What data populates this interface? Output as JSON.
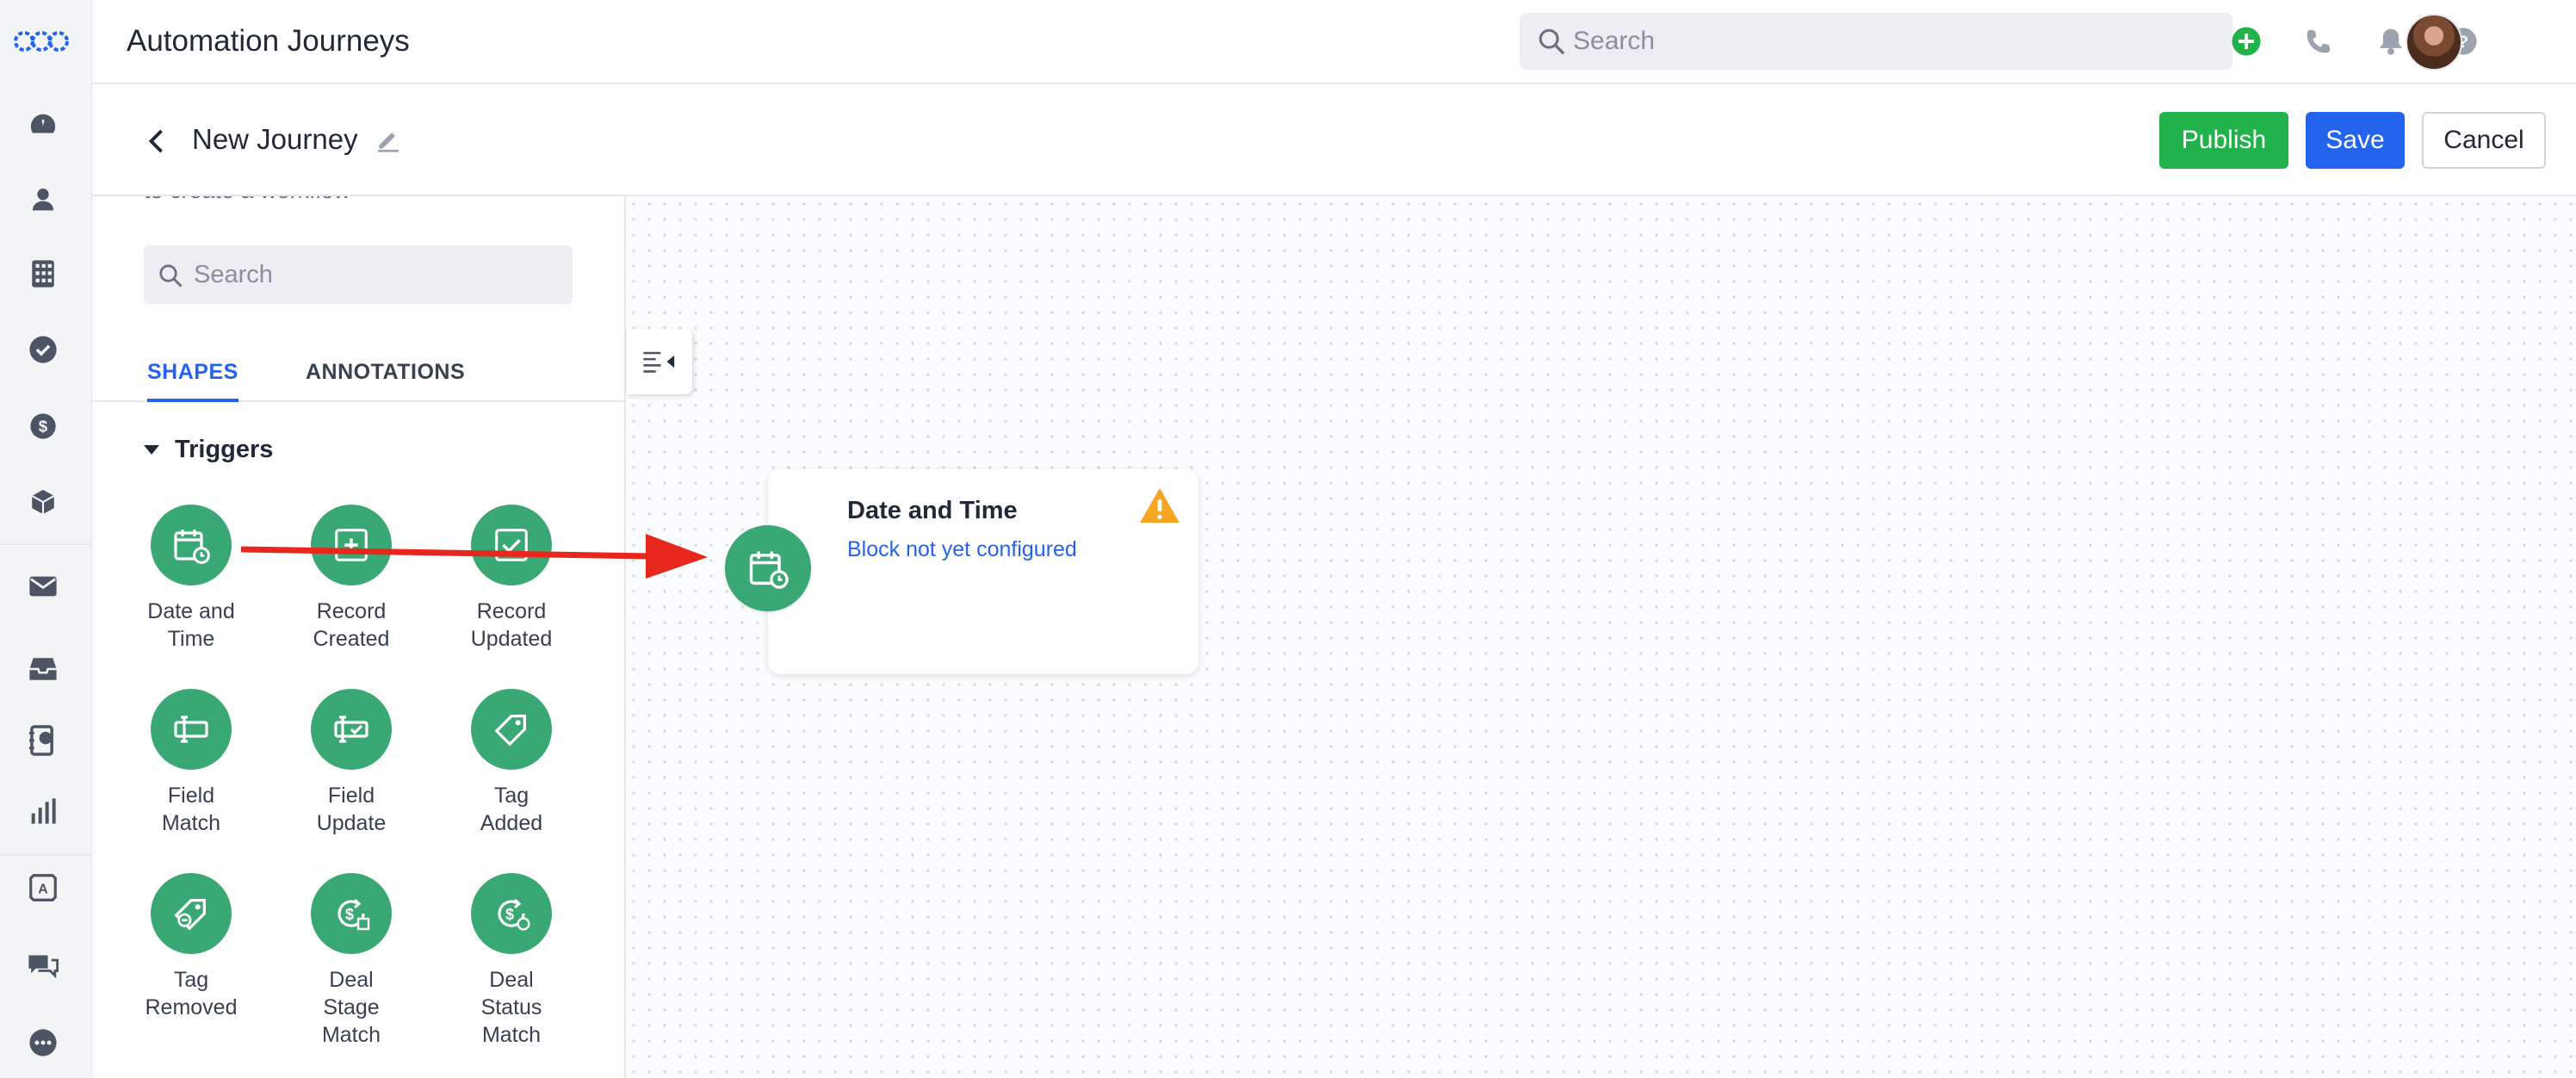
{
  "header": {
    "app_title": "Automation Journeys",
    "search_placeholder": "Search"
  },
  "subheader": {
    "journey_name": "New Journey",
    "publish_label": "Publish",
    "save_label": "Save",
    "cancel_label": "Cancel"
  },
  "panel": {
    "intro_text": "to create a workflow",
    "search_placeholder": "Search",
    "tabs": [
      {
        "label": "SHAPES",
        "active": true
      },
      {
        "label": "ANNOTATIONS",
        "active": false
      }
    ],
    "group_title": "Triggers",
    "shapes": [
      {
        "label": "Date and\nTime",
        "icon": "calendar-clock-icon"
      },
      {
        "label": "Record\nCreated",
        "icon": "record-plus-icon"
      },
      {
        "label": "Record\nUpdated",
        "icon": "record-check-icon"
      },
      {
        "label": "Field\nMatch",
        "icon": "field-match-icon"
      },
      {
        "label": "Field\nUpdate",
        "icon": "field-update-icon"
      },
      {
        "label": "Tag\nAdded",
        "icon": "tag-icon"
      },
      {
        "label": "Tag\nRemoved",
        "icon": "tag-minus-icon"
      },
      {
        "label": "Deal\nStage\nMatch",
        "icon": "deal-stage-icon"
      },
      {
        "label": "Deal\nStatus\nMatch",
        "icon": "deal-status-icon"
      }
    ]
  },
  "canvas": {
    "node": {
      "title": "Date and Time",
      "status": "Block not yet configured",
      "icon": "calendar-clock-icon",
      "warning_icon": "warning-triangle-icon"
    }
  },
  "colors": {
    "accent_blue": "#2463eb",
    "publish_green": "#22b24c",
    "shape_green": "#3aa874",
    "warning_orange": "#f5a623",
    "arrow_red": "#e8271c"
  },
  "rail_icons": [
    "logo-icon",
    "dashboard-icon",
    "contacts-icon",
    "accounts-icon",
    "tasks-icon",
    "deals-icon",
    "products-icon",
    "email-icon",
    "inbox-icon",
    "phone-book-icon",
    "reports-icon",
    "automations-icon",
    "chat-icon",
    "more-icon"
  ]
}
